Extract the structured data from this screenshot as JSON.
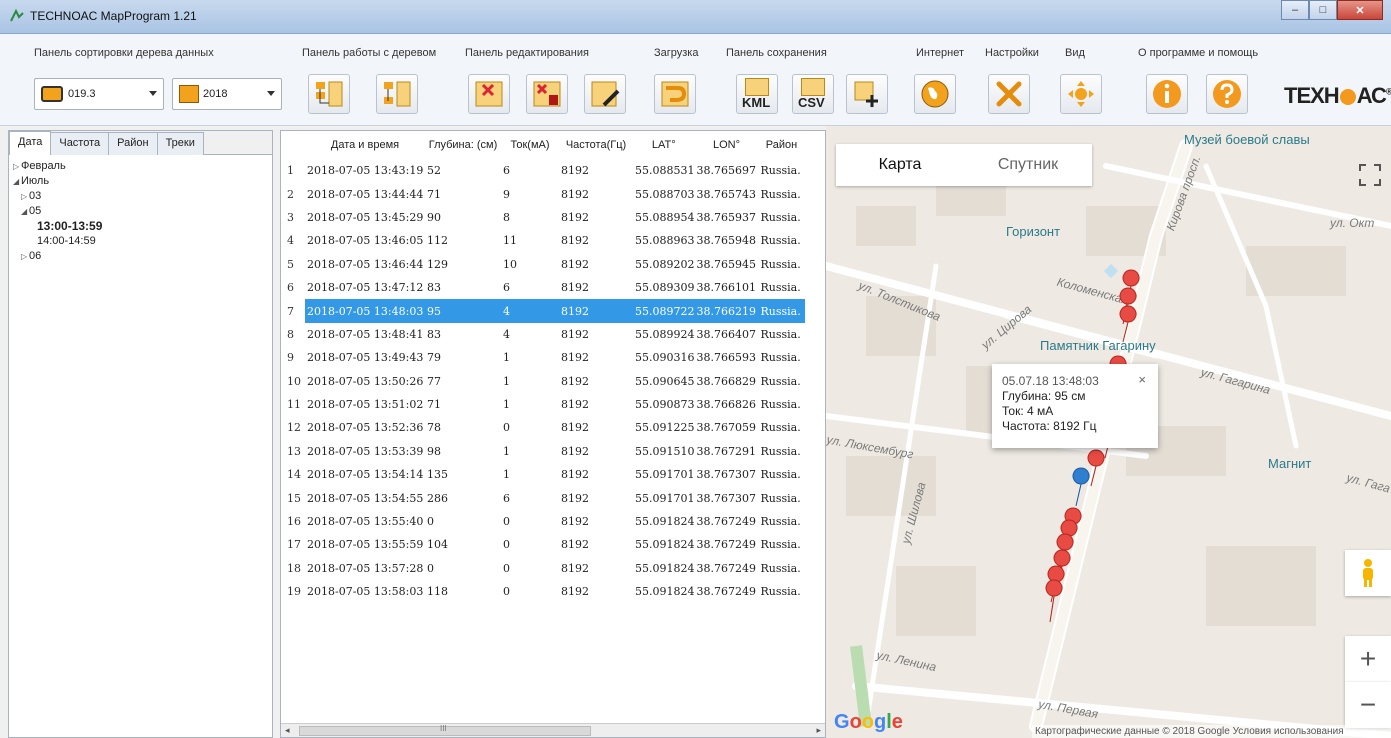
{
  "window": {
    "title": "TECHNOAC MapProgram 1.21",
    "minimize": "–",
    "maximize": "□",
    "close": "✕"
  },
  "ribbon": {
    "groups": {
      "sort": "Панель сортировки дерева данных",
      "tree": "Панель работы с деревом",
      "edit": "Панель редактирования",
      "load": "Загрузка",
      "save": "Панель сохранения",
      "internet": "Интернет",
      "settings": "Настройки",
      "view": "Вид",
      "about": "О программе и помощь"
    },
    "device_combo": "019.3",
    "year_combo": "2018",
    "kml_label": "KML",
    "csv_label": "CSV",
    "logo": {
      "prefix": "ТЕХН",
      "suffix": "АС",
      "mark": "®"
    }
  },
  "left_panel": {
    "tabs": [
      "Дата",
      "Частота",
      "Район",
      "Треки"
    ],
    "tree": {
      "feb": "Февраль",
      "jul": "Июль",
      "d03": "03",
      "d05": "05",
      "h13": "13:00-13:59",
      "h14": "14:00-14:59",
      "d06": "06"
    }
  },
  "table": {
    "columns": [
      "Дата и время",
      "Глубина: (см)",
      "Ток(мА)",
      "Частота(Гц)",
      "LAT°",
      "LON°",
      "Район"
    ],
    "selected_row": 7,
    "rows": [
      [
        "1",
        "2018-07-05 13:43:19",
        "52",
        "6",
        "8192",
        "55.088531",
        "38.765697",
        "Russia."
      ],
      [
        "2",
        "2018-07-05 13:44:44",
        "71",
        "9",
        "8192",
        "55.088703",
        "38.765743",
        "Russia."
      ],
      [
        "3",
        "2018-07-05 13:45:29",
        "90",
        "8",
        "8192",
        "55.088954",
        "38.765937",
        "Russia."
      ],
      [
        "4",
        "2018-07-05 13:46:05",
        "112",
        "11",
        "8192",
        "55.088963",
        "38.765948",
        "Russia."
      ],
      [
        "5",
        "2018-07-05 13:46:44",
        "129",
        "10",
        "8192",
        "55.089202",
        "38.765945",
        "Russia."
      ],
      [
        "6",
        "2018-07-05 13:47:12",
        "83",
        "6",
        "8192",
        "55.089309",
        "38.766101",
        "Russia."
      ],
      [
        "7",
        "2018-07-05 13:48:03",
        "95",
        "4",
        "8192",
        "55.089722",
        "38.766219",
        "Russia."
      ],
      [
        "8",
        "2018-07-05 13:48:41",
        "83",
        "4",
        "8192",
        "55.089924",
        "38.766407",
        "Russia."
      ],
      [
        "9",
        "2018-07-05 13:49:43",
        "79",
        "1",
        "8192",
        "55.090316",
        "38.766593",
        "Russia."
      ],
      [
        "10",
        "2018-07-05 13:50:26",
        "77",
        "1",
        "8192",
        "55.090645",
        "38.766829",
        "Russia."
      ],
      [
        "11",
        "2018-07-05 13:51:02",
        "71",
        "1",
        "8192",
        "55.090873",
        "38.766826",
        "Russia."
      ],
      [
        "12",
        "2018-07-05 13:52:36",
        "78",
        "0",
        "8192",
        "55.091225",
        "38.767059",
        "Russia."
      ],
      [
        "13",
        "2018-07-05 13:53:39",
        "98",
        "1",
        "8192",
        "55.091510",
        "38.767291",
        "Russia."
      ],
      [
        "14",
        "2018-07-05 13:54:14",
        "135",
        "1",
        "8192",
        "55.091701",
        "38.767307",
        "Russia."
      ],
      [
        "15",
        "2018-07-05 13:54:55",
        "286",
        "6",
        "8192",
        "55.091701",
        "38.767307",
        "Russia."
      ],
      [
        "16",
        "2018-07-05 13:55:40",
        "0",
        "0",
        "8192",
        "55.091824",
        "38.767249",
        "Russia."
      ],
      [
        "17",
        "2018-07-05 13:55:59",
        "104",
        "0",
        "8192",
        "55.091824",
        "38.767249",
        "Russia."
      ],
      [
        "18",
        "2018-07-05 13:57:28",
        "0",
        "0",
        "8192",
        "55.091824",
        "38.767249",
        "Russia."
      ],
      [
        "19",
        "2018-07-05 13:58:03",
        "118",
        "0",
        "8192",
        "55.091824",
        "38.767249",
        "Russia."
      ]
    ],
    "scroll_thumb_label": "III"
  },
  "map": {
    "type_map": "Карта",
    "type_satellite": "Спутник",
    "poi": {
      "museum": "Музей боевой славы",
      "gorizont": "Горизонт",
      "monument": "Памятник Гагарину",
      "magnit": "Магнит"
    },
    "streets": {
      "okt": "ул. Окт",
      "tolstikova": "ул. Толстикова",
      "shirova": "ул. Цирова",
      "kolomenskaya": "Коломенская",
      "gagarina": "ул. Гагарина",
      "luksemburg": "ул. Люксембург",
      "shilova": "ул. Шилова",
      "lenina": "ул. Ленина",
      "pervaya": "ул. Первая",
      "kirova": "Кирова просп.",
      "gagarin_r": "ул. Гага"
    },
    "popup": {
      "datetime": "05.07.18 13:48:03",
      "close": "×",
      "depth": "Глубина: 95 см",
      "current": "Ток: 4 мА",
      "freq": "Частота: 8192 Гц"
    },
    "zoom_in": "+",
    "zoom_out": "−",
    "google_logo": "Google",
    "copyright": "Картографические данные © 2018 Google   Условия использования"
  }
}
